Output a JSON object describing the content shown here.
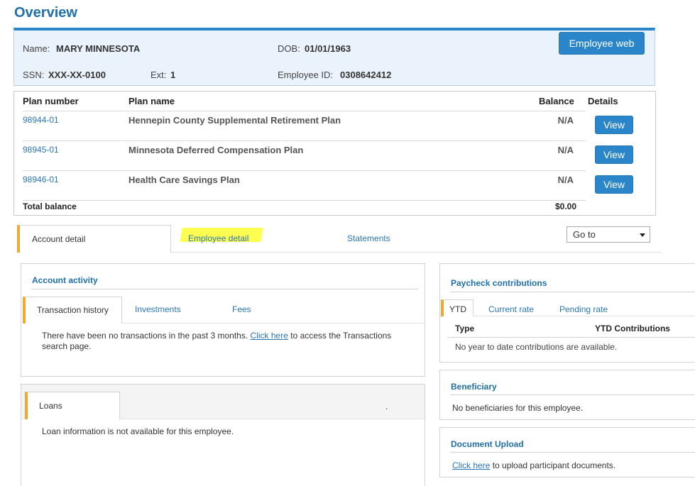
{
  "title": "Overview",
  "employee": {
    "name_label": "Name:",
    "name": "MARY MINNESOTA",
    "dob_label": "DOB:",
    "dob": "01/01/1963",
    "ssn_label": "SSN:",
    "ssn": "XXX-XX-0100",
    "ext_label": "Ext:",
    "ext": "1",
    "id_label": "Employee ID:",
    "id": "0308642412",
    "web_button": "Employee web"
  },
  "plans": {
    "headers": [
      "Plan number",
      "Plan name",
      "Balance",
      "Details"
    ],
    "rows": [
      {
        "number": "98944-01",
        "name": "Hennepin County Supplemental Retirement Plan",
        "balance": "N/A",
        "action": "View"
      },
      {
        "number": "98945-01",
        "name": "Minnesota Deferred Compensation Plan",
        "balance": "N/A",
        "action": "View"
      },
      {
        "number": "98946-01",
        "name": "Health Care Savings Plan",
        "balance": "N/A",
        "action": "View"
      }
    ],
    "total_label": "Total balance",
    "total": "$0.00"
  },
  "main_tabs": [
    "Account detail",
    "Employee detail",
    "Statements"
  ],
  "goto": {
    "selected": "Go to"
  },
  "account_activity": {
    "title": "Account activity",
    "tabs": [
      "Transaction history",
      "Investments",
      "Fees"
    ],
    "text_before": "There have been no transactions in the past 3 months.",
    "link": "Click here",
    "text_after": "to access the Transactions",
    "text_line2": "search page."
  },
  "loans": {
    "tab": "Loans",
    "dot": ".",
    "text": "Loan information is not available for this employee."
  },
  "paycheck": {
    "title": "Paycheck contributions",
    "tabs": [
      "YTD",
      "Current rate",
      "Pending rate"
    ],
    "col_type": "Type",
    "col_ytd": "YTD Contributions",
    "empty": "No year to date contributions are available."
  },
  "beneficiary": {
    "title": "Beneficiary",
    "text": "No beneficiaries for this employee."
  },
  "document_upload": {
    "title": "Document Upload",
    "link": "Click here",
    "text": "to upload participant documents."
  },
  "colors": {
    "accent": "#2a86c8",
    "tab_marker": "#f0a830",
    "highlight": "#ffff33"
  }
}
